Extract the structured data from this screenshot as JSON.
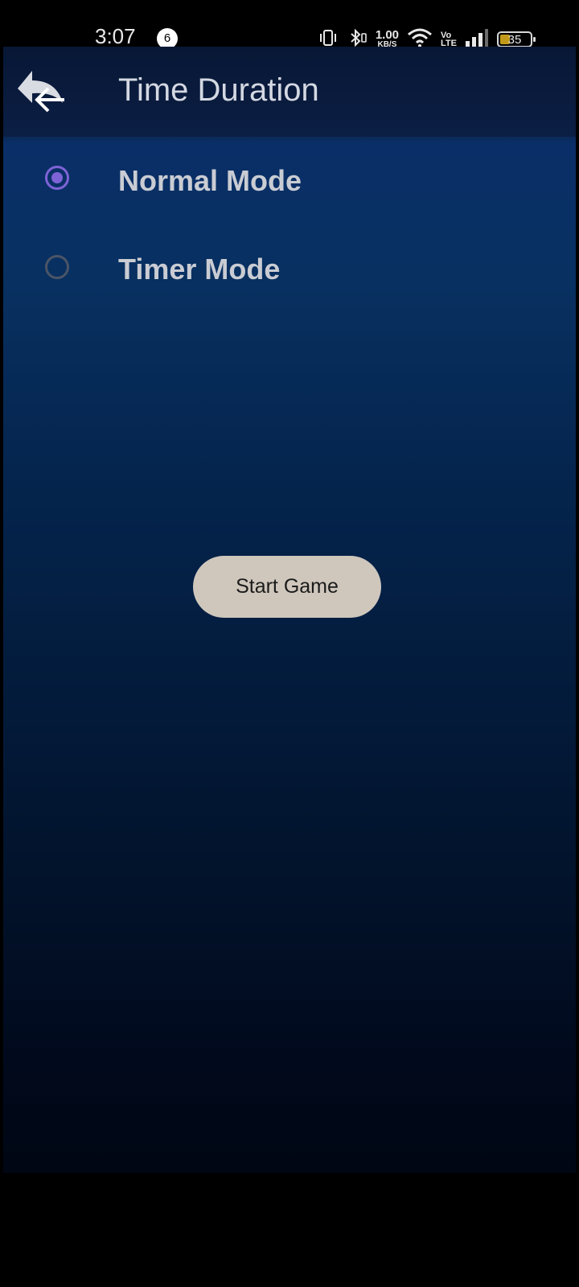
{
  "status_bar": {
    "time": "3:07",
    "notification_count": "6",
    "net_speed_value": "1.00",
    "net_speed_unit": "KB/S",
    "volte_top": "Vo",
    "volte_bottom": "LTE",
    "battery_level": "35",
    "icons": [
      "vibrate-icon",
      "bluetooth-icon",
      "wifi-icon",
      "signal-icon",
      "battery-icon"
    ]
  },
  "header": {
    "title": "Time Duration",
    "back_icon": "back-arrow-icon"
  },
  "options": [
    {
      "label": "Normal Mode",
      "checked": true
    },
    {
      "label": "Timer Mode",
      "checked": false
    }
  ],
  "start_button": {
    "label": "Start Game"
  },
  "colors": {
    "accent": "#7e63d6",
    "button_bg": "#cfc7bc",
    "text": "#c9ccd3"
  }
}
